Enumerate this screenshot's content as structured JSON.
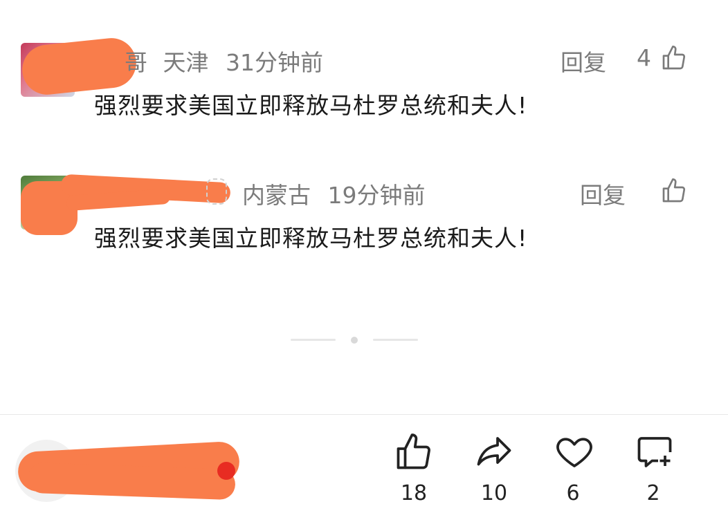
{
  "comments": [
    {
      "name_fragment": "哥",
      "location": "天津",
      "time": "31分钟前",
      "reply_label": "回复",
      "like_count": "4",
      "text": "强烈要求美国立即释放马杜罗总统和夫人!"
    },
    {
      "location": "内蒙古",
      "time": "19分钟前",
      "reply_label": "回复",
      "like_count": "",
      "text": "强烈要求美国立即释放马杜罗总统和夫人!"
    }
  ],
  "bottom_bar": {
    "like_count": "18",
    "share_count": "10",
    "favorite_count": "6",
    "comment_count": "2"
  },
  "icons": {
    "like": "thumbs-up-icon",
    "share": "share-arrow-icon",
    "favorite": "heart-icon",
    "comment": "comment-add-icon"
  },
  "colors": {
    "redaction": "#f97d4b",
    "meta_text": "#7b7b7b"
  }
}
